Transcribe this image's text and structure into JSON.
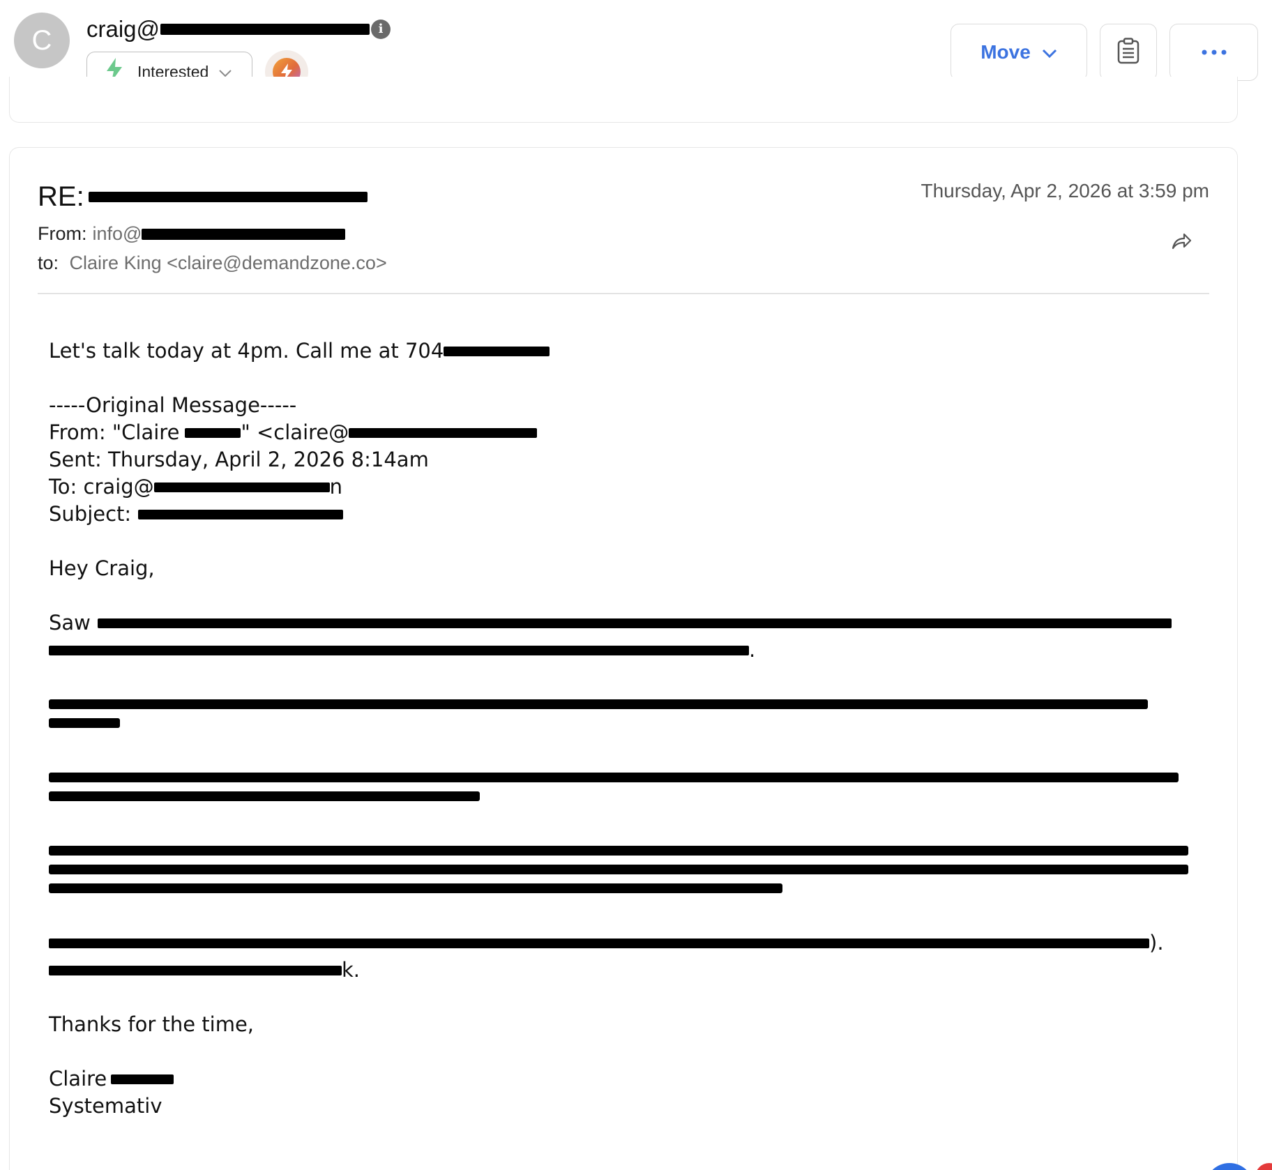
{
  "header": {
    "avatar_initial": "C",
    "sender_prefix": "craig@",
    "info_icon": "info-icon",
    "status_label": "Interested",
    "status_icon": "bolt-icon",
    "ai_icon": "ai-bolt-icon",
    "move_label": "Move",
    "notes_icon": "clipboard-icon",
    "more_icon": "more-dots-icon"
  },
  "email": {
    "subject_prefix": "RE:",
    "date": "Thursday, Apr 2, 2026 at 3:59 pm",
    "from_label": "From:",
    "from_value": "info@",
    "to_label": "to:",
    "to_value": "Claire King <claire@demandzone.co>",
    "forward_icon": "forward-icon"
  },
  "body": {
    "reply_line": "Let's talk today at 4pm. Call me at 704",
    "original_header": "-----Original Message-----",
    "orig_from": "From: \"Claire",
    "orig_from_email": "\" <claire@",
    "orig_sent": "Sent: Thursday, April 2, 2026 8:14am",
    "orig_to": "To: craig@",
    "orig_to_suffix": "n",
    "orig_subject": "Subject:",
    "greeting": "Hey Craig,",
    "saw_prefix": "Saw",
    "p1_end": ".",
    "p5_end": ").",
    "p5b_end": "k.",
    "closing": "Thanks for the time,",
    "sign_name": "Claire",
    "sign_company": "Systemativ"
  },
  "colors": {
    "accent": "#3c73e0",
    "avatar_bg": "#c6c6c6",
    "status_green": "#58c27d"
  }
}
